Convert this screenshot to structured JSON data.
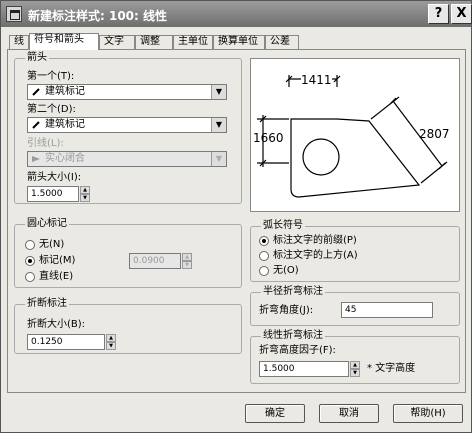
{
  "window": {
    "title": "新建标注样式: 100: 线性",
    "help_btn": "?",
    "close_btn": "X"
  },
  "tabs": [
    {
      "label": "线"
    },
    {
      "label": "符号和箭头",
      "active": true
    },
    {
      "label": "文字"
    },
    {
      "label": "调整"
    },
    {
      "label": "主单位"
    },
    {
      "label": "换算单位"
    },
    {
      "label": "公差"
    }
  ],
  "arrows": {
    "group_title": "箭头",
    "first_label": "第一个(T):",
    "first_value": "建筑标记",
    "second_label": "第二个(D):",
    "second_value": "建筑标记",
    "leader_label": "引线(L):",
    "leader_value": "实心闭合",
    "size_label": "箭头大小(I):",
    "size_value": "1.5000"
  },
  "center_marks": {
    "group_title": "圆心标记",
    "none_label": "无(N)",
    "mark_label": "标记(M)",
    "line_label": "直线(E)",
    "size_value": "0.0900",
    "selected": "mark"
  },
  "break": {
    "group_title": "折断标注",
    "size_label": "折断大小(B):",
    "size_value": "0.1250"
  },
  "arc_length": {
    "group_title": "弧长符号",
    "opt1": "标注文字的前缀(P)",
    "opt2": "标注文字的上方(A)",
    "opt3": "无(O)",
    "selected": "opt1"
  },
  "radius_jog": {
    "group_title": "半径折弯标注",
    "angle_label": "折弯角度(J):",
    "angle_value": "45"
  },
  "linear_jog": {
    "group_title": "线性折弯标注",
    "factor_label": "折弯高度因子(F):",
    "factor_value": "1.5000",
    "suffix": "* 文字高度"
  },
  "preview": {
    "dim_top": "1411",
    "dim_left": "1660",
    "dim_right": "2807"
  },
  "buttons": {
    "ok": "确定",
    "cancel": "取消",
    "help": "帮助(H)"
  }
}
